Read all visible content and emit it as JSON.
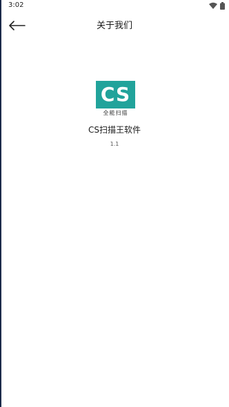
{
  "status_bar": {
    "time": "3:02",
    "icons": [
      "wifi-icon",
      "battery-icon"
    ]
  },
  "header": {
    "back_icon": "arrow-left-icon",
    "title": "关于我们"
  },
  "about": {
    "logo": {
      "letters": "CS",
      "caption": "全能扫描",
      "brand_color": "#21a39b"
    },
    "app_name": "CS扫描王软件",
    "version": "1.1"
  }
}
